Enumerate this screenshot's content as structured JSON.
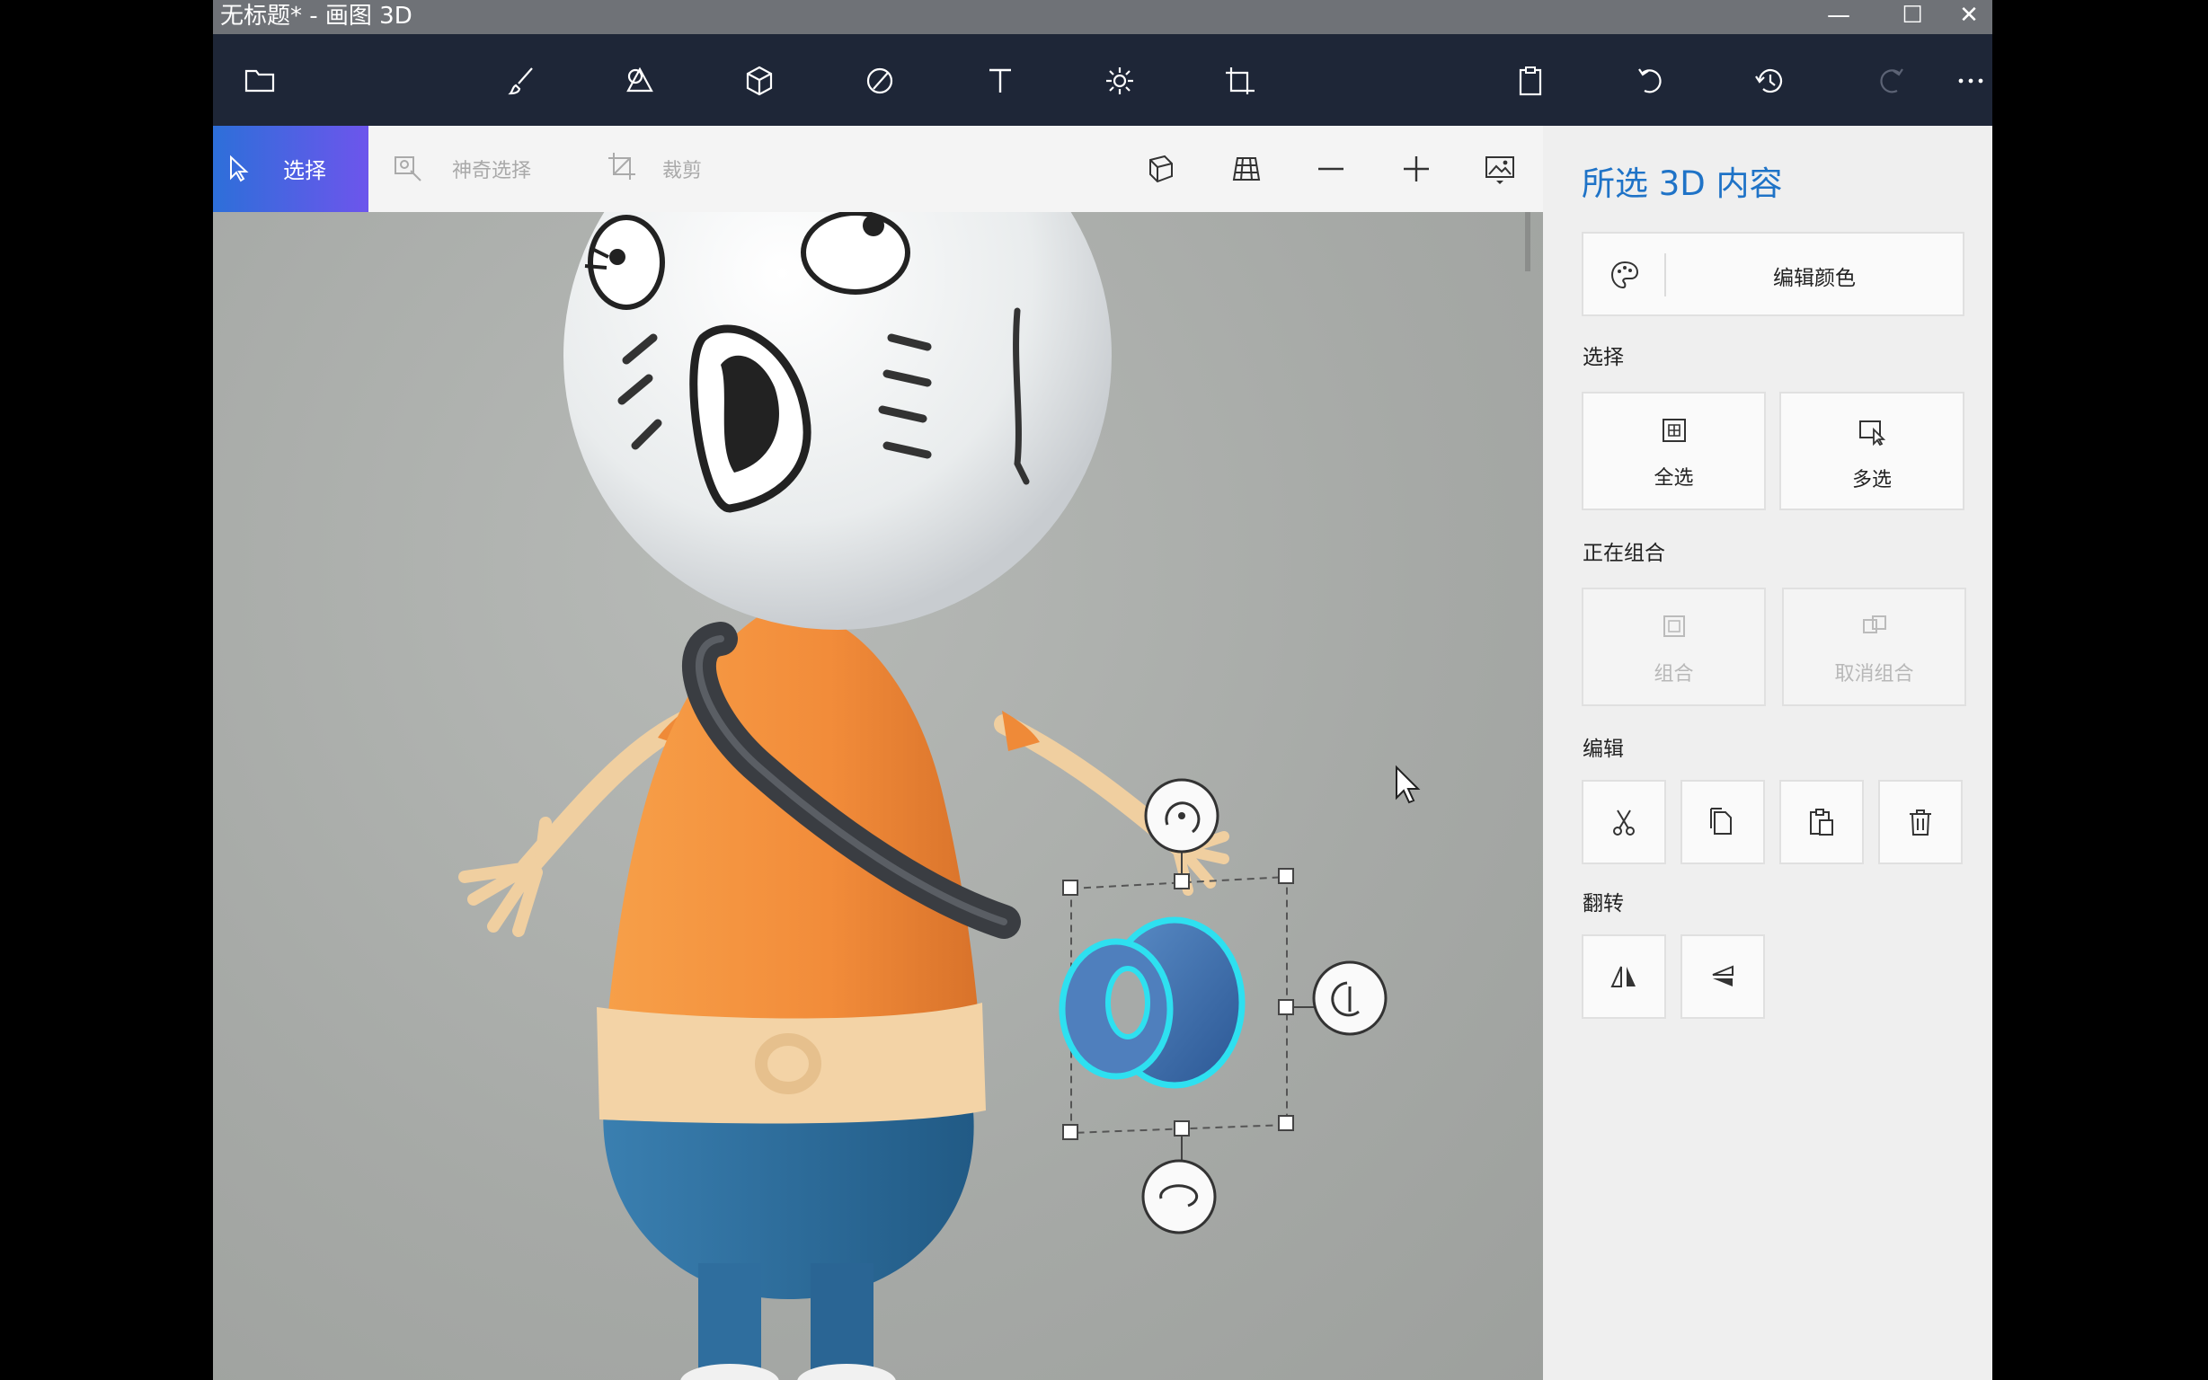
{
  "window": {
    "title": "无标题* - 画图 3D",
    "controls": [
      "minimize",
      "maximize",
      "close"
    ]
  },
  "appbar": {
    "icons": [
      "folder-icon",
      "brush-icon",
      "2d-shapes-icon",
      "3d-shapes-icon",
      "stickers-icon",
      "text-icon",
      "effects-icon",
      "canvas-icon",
      "paste-icon",
      "undo-icon",
      "history-icon",
      "redo-icon",
      "more-icon"
    ]
  },
  "toolbar": {
    "select_label": "选择",
    "magic_select_label": "神奇选择",
    "crop_label": "裁剪",
    "right_icons": [
      "3d-view-icon",
      "grid-view-icon",
      "zoom-out-icon",
      "zoom-in-icon",
      "background-image-icon"
    ]
  },
  "panel": {
    "title": "所选 3D 内容",
    "edit_color_label": "编辑颜色",
    "select_section": "选择",
    "select_all_label": "全选",
    "multi_select_label": "多选",
    "group_section": "正在组合",
    "group_label": "组合",
    "ungroup_label": "取消组合",
    "edit_section": "编辑",
    "edit_actions": [
      "cut-icon",
      "copy-icon",
      "paste-icon",
      "delete-icon"
    ],
    "flip_section": "翻转",
    "flip_actions": [
      "flip-horizontal-icon",
      "flip-vertical-icon"
    ]
  },
  "colors": {
    "accent": "#1f73c7",
    "titlebar": "#6f7277",
    "appbar": "#1e2637",
    "selection_ring": "#2ee0f0",
    "shirt": "#f28c3a",
    "pants": "#2f6e9e",
    "skin": "#f3d3a6"
  }
}
